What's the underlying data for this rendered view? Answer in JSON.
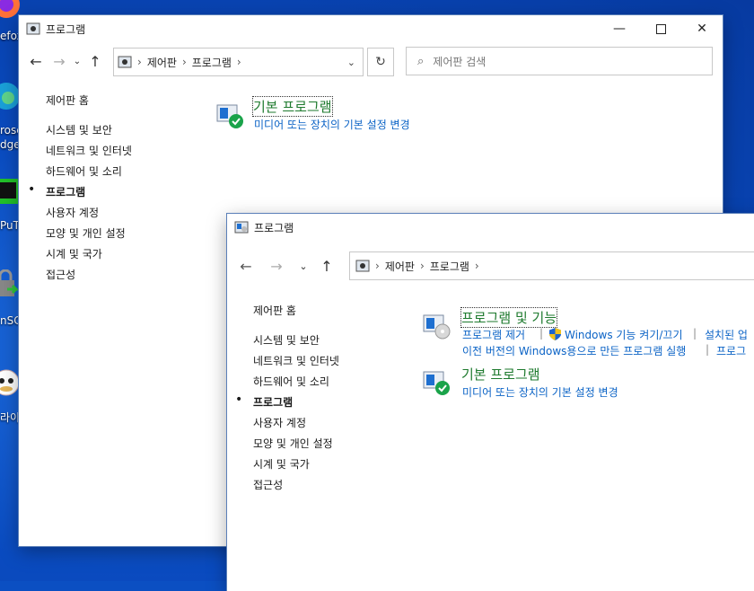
{
  "desktop": {
    "icons": [
      {
        "label": "efox"
      },
      {
        "label": "rosc"
      },
      {
        "label": "dge"
      },
      {
        "label": "PuT"
      },
      {
        "label": "nSC"
      },
      {
        "label": "라이"
      }
    ]
  },
  "back_window": {
    "title": "프로그램",
    "address": {
      "crumbs": [
        "제어판",
        "프로그램"
      ]
    },
    "search_placeholder": "제어판 검색",
    "sidebar": {
      "home": "제어판 홈",
      "items": [
        "시스템 및 보안",
        "네트워크 및 인터넷",
        "하드웨어 및 소리",
        "프로그램",
        "사용자 계정",
        "모양 및 개인 설정",
        "시계 및 국가",
        "접근성"
      ],
      "active_index": 3
    },
    "category": {
      "title": "기본 프로그램",
      "link": "미디어 또는 장치의 기본 설정 변경"
    }
  },
  "front_window": {
    "title": "프로그램",
    "address": {
      "crumbs": [
        "제어판",
        "프로그램"
      ]
    },
    "sidebar": {
      "home": "제어판 홈",
      "items": [
        "시스템 및 보안",
        "네트워크 및 인터넷",
        "하드웨어 및 소리",
        "프로그램",
        "사용자 계정",
        "모양 및 개인 설정",
        "시계 및 국가",
        "접근성"
      ],
      "active_index": 3
    },
    "categories": [
      {
        "title": "프로그램 및 기능",
        "links_row1": [
          "프로그램 제거",
          "Windows 기능 켜기/끄기",
          "설치된 업"
        ],
        "links_row2": [
          "이전 버전의 Windows용으로 만든 프로그램 실행",
          "프로그"
        ]
      },
      {
        "title": "기본 프로그램",
        "link": "미디어 또는 장치의 기본 설정 변경"
      }
    ]
  },
  "colors": {
    "link": "#0b63c6",
    "category_title": "#1e7a2e",
    "desktop": "#0a4bc0"
  }
}
